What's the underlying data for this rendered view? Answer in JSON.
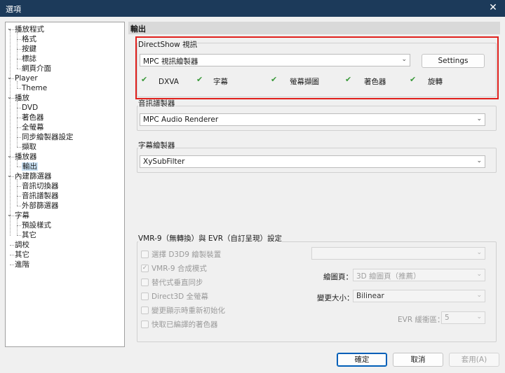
{
  "window": {
    "title": "選項",
    "close_glyph": "✕"
  },
  "tree": [
    {
      "label": "播放程式",
      "expander": "⌄"
    },
    {
      "label": "格式"
    },
    {
      "label": "按鍵"
    },
    {
      "label": "標誌"
    },
    {
      "label": "網頁介面"
    },
    {
      "label": "Player",
      "expander": "⌄"
    },
    {
      "label": "Theme"
    },
    {
      "label": "播放",
      "expander": "⌄"
    },
    {
      "label": "DVD"
    },
    {
      "label": "著色器"
    },
    {
      "label": "全螢幕"
    },
    {
      "label": "同步繪製器設定"
    },
    {
      "label": "擷取"
    },
    {
      "label": "播放器",
      "expander": "⌄"
    },
    {
      "label": "輸出",
      "selected": true
    },
    {
      "label": "內建篩選器",
      "expander": "⌄"
    },
    {
      "label": "音訊切換器"
    },
    {
      "label": "音訊譜製器"
    },
    {
      "label": "外部篩選器"
    },
    {
      "label": "字幕",
      "expander": "⌄"
    },
    {
      "label": "預設樣式"
    },
    {
      "label": "其它"
    },
    {
      "label": "調校"
    },
    {
      "label": "其它"
    },
    {
      "label": "進階"
    }
  ],
  "page": {
    "title": "輸出",
    "directshow": {
      "group_label": "DirectShow 視訊",
      "renderer": "MPC 視訊繪製器",
      "settings_button": "Settings",
      "features": [
        "DXVA",
        "字幕",
        "螢幕擷圖",
        "著色器",
        "旋轉"
      ],
      "check_glyph": "✔"
    },
    "audio": {
      "group_label": "音訊譜製器",
      "renderer": "MPC Audio Renderer"
    },
    "subtitle": {
      "group_label": "字幕繪製器",
      "renderer": "XySubFilter"
    },
    "vmr": {
      "group_label": "VMR-9（無轉換）與 EVR（自訂呈現）設定",
      "options": [
        {
          "label": "選擇 D3D9 繪製裝置",
          "checked": false
        },
        {
          "label": "VMR-9 合成模式",
          "checked": true
        },
        {
          "label": "替代式垂直同步",
          "checked": false
        },
        {
          "label": "Direct3D 全螢幕",
          "checked": false
        },
        {
          "label": "變更顯示時重新初始化",
          "checked": false
        },
        {
          "label": "快取已編譯的著色器",
          "checked": false
        }
      ],
      "d3d_device": "",
      "surface_label": "繪圖頁：",
      "surface_value": "3D 繪圖頁（推薦）",
      "resize_label": "變更大小：",
      "resize_value": "Bilinear",
      "evr_label": "EVR 緩衝區：",
      "evr_value": "5"
    }
  },
  "footer": {
    "ok": "確定",
    "cancel": "取消",
    "apply": "套用(A)"
  },
  "glyphs": {
    "dropdown": "⌄",
    "checkbox_checked": "✓"
  }
}
